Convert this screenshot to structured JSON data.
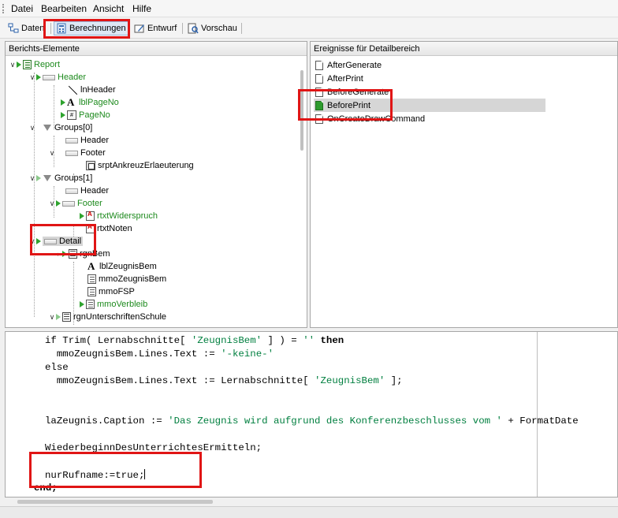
{
  "menu": [
    "Datei",
    "Bearbeiten",
    "Ansicht",
    "Hilfe"
  ],
  "toolbar": {
    "tabs": [
      {
        "label": "Daten",
        "icon": "data-icon",
        "active": false
      },
      {
        "label": "Berechnungen",
        "icon": "calculator-icon",
        "active": true
      },
      {
        "label": "Entwurf",
        "icon": "design-icon",
        "active": false
      },
      {
        "label": "Vorschau",
        "icon": "preview-icon",
        "active": false
      }
    ]
  },
  "tree": {
    "header": "Berichts-Elemente",
    "nodes": [
      {
        "label": "Report",
        "green": true
      },
      {
        "label": "Header",
        "green": true
      },
      {
        "label": "lnHeader",
        "green": false
      },
      {
        "label": "lblPageNo",
        "green": true
      },
      {
        "label": "PageNo",
        "green": true
      },
      {
        "label": "Groups[0]",
        "green": false
      },
      {
        "label": "Header",
        "green": false
      },
      {
        "label": "Footer",
        "green": false
      },
      {
        "label": "srptAnkreuzErlaeuterung",
        "green": false
      },
      {
        "label": "Groups[1]",
        "green": false
      },
      {
        "label": "Header",
        "green": false
      },
      {
        "label": "Footer",
        "green": true
      },
      {
        "label": "rtxtWiderspruch",
        "green": true
      },
      {
        "label": "rtxtNoten",
        "green": false
      },
      {
        "label": "Detail",
        "green": false
      },
      {
        "label": "rgnBem",
        "green": false
      },
      {
        "label": "lblZeugnisBem",
        "green": false
      },
      {
        "label": "mmoZeugnisBem",
        "green": false
      },
      {
        "label": "mmoFSP",
        "green": false
      },
      {
        "label": "mmoVerbleib",
        "green": true
      },
      {
        "label": "rgnUnterschriftenSchule",
        "green": false
      }
    ]
  },
  "events": {
    "header": "Ereignisse für Detailbereich",
    "items": [
      "AfterGenerate",
      "AfterPrint",
      "BeforeGenerate",
      "BeforePrint",
      "OnCreateDrawCommand"
    ],
    "selected": "BeforePrint"
  },
  "code": {
    "l1_a": "if Trim( Lernabschnitte[ ",
    "l1_s": "'ZeugnisBem'",
    "l1_b": " ] ) = ",
    "l1_s2": "''",
    "l1_kw": "then",
    "l2_a": "  mmoZeugnisBem.Lines.Text := ",
    "l2_s": "'-keine-'",
    "l3": "else",
    "l4_a": "  mmoZeugnisBem.Lines.Text := Lernabschnitte[ ",
    "l4_s": "'ZeugnisBem'",
    "l4_b": " ];",
    "l5_a": "laZeugnis.Caption := ",
    "l5_s": "'Das Zeugnis wird aufgrund des Konferenzbeschlusses vom '",
    "l5_b": " + FormatDate",
    "l6": "WiederbeginnDesUnterrichtesErmitteln;",
    "l7": "nurRufname:=true;",
    "l8": "end;"
  },
  "colors": {
    "highlight": "#e01515",
    "green": "#1d8a1d",
    "selection": "#d6d6d6"
  }
}
